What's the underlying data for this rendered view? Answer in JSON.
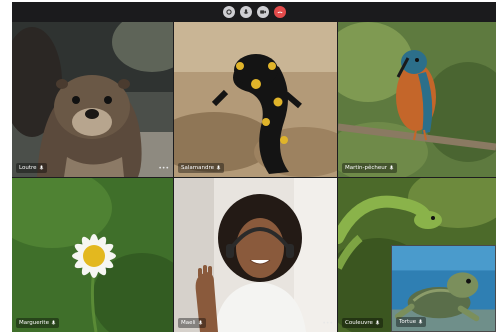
{
  "call_controls": [
    {
      "id": "ctrl-1",
      "icon": "settings-icon"
    },
    {
      "id": "ctrl-2",
      "icon": "microphone-icon"
    },
    {
      "id": "ctrl-3",
      "icon": "camera-icon"
    },
    {
      "id": "ctrl-4",
      "icon": "end-call-icon",
      "color": "#e34b4b"
    }
  ],
  "participants": [
    {
      "name": "Loutre",
      "icon": "microphone-icon"
    },
    {
      "name": "Salamandre",
      "icon": "microphone-icon"
    },
    {
      "name": "Martin-pêcheur",
      "icon": "microphone-icon"
    },
    {
      "name": "Marguerite",
      "icon": "microphone-icon"
    },
    {
      "name": "Maeli",
      "icon": "microphone-icon"
    },
    {
      "name": "Couleuvre",
      "icon": "microphone-icon"
    },
    {
      "name": "Tortue",
      "icon": "microphone-icon"
    }
  ],
  "more_label": "•••"
}
